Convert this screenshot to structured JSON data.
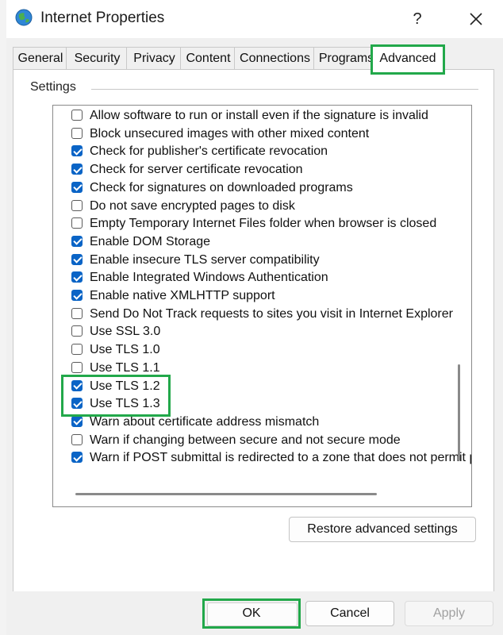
{
  "window": {
    "title": "Internet Properties",
    "help_label": "?"
  },
  "tabs": [
    {
      "label": "General"
    },
    {
      "label": "Security"
    },
    {
      "label": "Privacy"
    },
    {
      "label": "Content"
    },
    {
      "label": "Connections"
    },
    {
      "label": "Programs"
    },
    {
      "label": "Advanced",
      "active": true
    }
  ],
  "settings": {
    "group_label": "Settings",
    "items": [
      {
        "label": "Allow software to run or install even if the signature is invalid",
        "checked": false
      },
      {
        "label": "Block unsecured images with other mixed content",
        "checked": false
      },
      {
        "label": "Check for publisher's certificate revocation",
        "checked": true
      },
      {
        "label": "Check for server certificate revocation",
        "checked": true
      },
      {
        "label": "Check for signatures on downloaded programs",
        "checked": true
      },
      {
        "label": "Do not save encrypted pages to disk",
        "checked": false
      },
      {
        "label": "Empty Temporary Internet Files folder when browser is closed",
        "checked": false
      },
      {
        "label": "Enable DOM Storage",
        "checked": true
      },
      {
        "label": "Enable insecure TLS server compatibility",
        "checked": true
      },
      {
        "label": "Enable Integrated Windows Authentication",
        "checked": true
      },
      {
        "label": "Enable native XMLHTTP support",
        "checked": true
      },
      {
        "label": "Send Do Not Track requests to sites you visit in Internet Explorer",
        "checked": false
      },
      {
        "label": "Use SSL 3.0",
        "checked": false
      },
      {
        "label": "Use TLS 1.0",
        "checked": false
      },
      {
        "label": "Use TLS 1.1",
        "checked": false
      },
      {
        "label": "Use TLS 1.2",
        "checked": true
      },
      {
        "label": "Use TLS 1.3",
        "checked": true
      },
      {
        "label": "Warn about certificate address mismatch",
        "checked": true
      },
      {
        "label": "Warn if changing between secure and not secure mode",
        "checked": false
      },
      {
        "label": "Warn if POST submittal is redirected to a zone that does not permit posts",
        "checked": true
      }
    ],
    "restore_label": "Restore advanced settings"
  },
  "footer": {
    "ok_label": "OK",
    "cancel_label": "Cancel",
    "apply_label": "Apply"
  },
  "colors": {
    "highlight": "#22a84a",
    "checkbox_checked": "#0a64c6"
  }
}
